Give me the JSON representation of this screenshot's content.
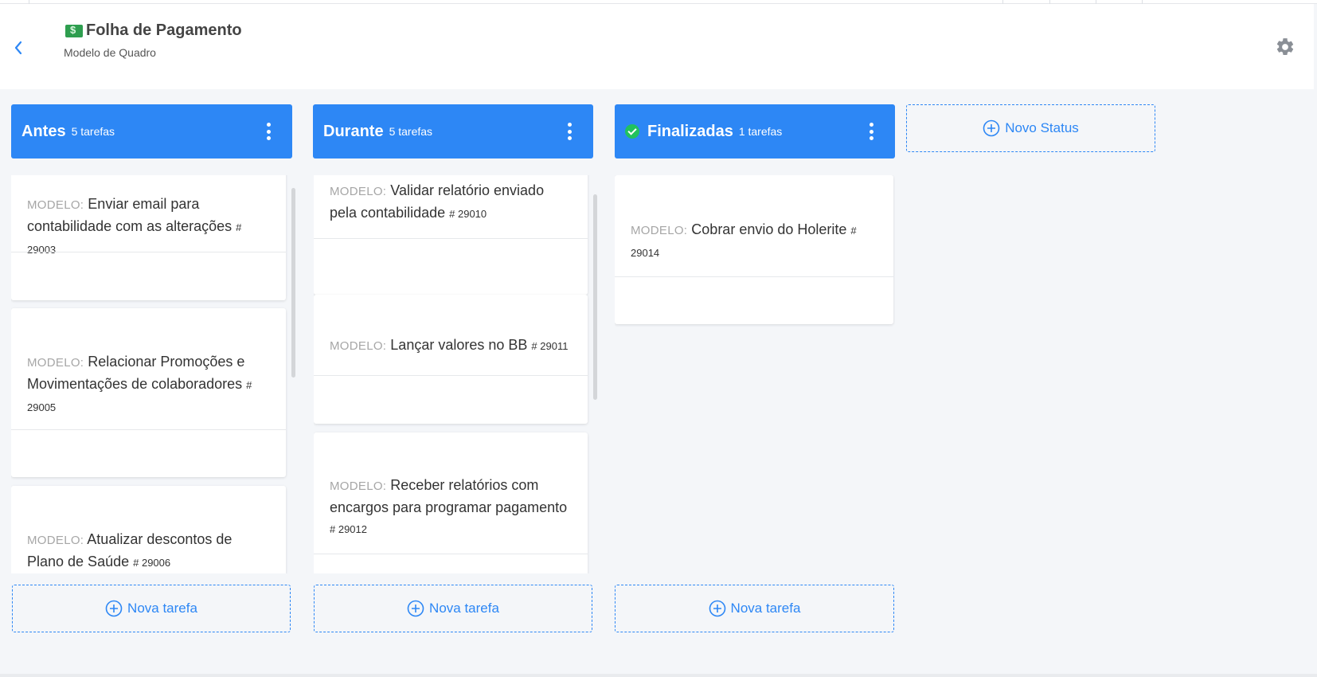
{
  "header": {
    "title": "Folha de Pagamento",
    "subtitle": "Modelo de Quadro",
    "title_icon": "money-icon",
    "back_icon": "chevron-left-icon",
    "settings_icon": "gear-icon"
  },
  "colors": {
    "accent": "#2d87f5",
    "done": "#21c25e",
    "background": "#f4f6f9"
  },
  "columns": [
    {
      "name": "Antes",
      "count": "5 tarefas",
      "add_label": "Nova tarefa",
      "cards": [
        {
          "label": "MODELO:",
          "text": "Enviar email para contabilidade com as alterações",
          "number": "# 29003"
        },
        {
          "label": "MODELO:",
          "text": "Relacionar Promoções e Movimentações de colaboradores",
          "number": "# 29005"
        },
        {
          "label": "MODELO:",
          "text": "Atualizar descontos de Plano de Saúde",
          "number": "# 29006"
        }
      ]
    },
    {
      "name": "Durante",
      "count": "5 tarefas",
      "add_label": "Nova tarefa",
      "cards": [
        {
          "label": "MODELO:",
          "text": "Validar relatório enviado pela contabilidade",
          "number": "# 29010"
        },
        {
          "label": "MODELO:",
          "text": "Lançar valores no BB",
          "number": "# 29011"
        },
        {
          "label": "MODELO:",
          "text": "Receber relatórios com encargos para programar pagamento",
          "number": "# 29012"
        }
      ]
    },
    {
      "name": "Finalizadas",
      "count": "1 tarefas",
      "add_label": "Nova tarefa",
      "cards": [
        {
          "label": "MODELO:",
          "text": "Cobrar envio do Holerite",
          "number": "# 29014"
        }
      ]
    }
  ],
  "new_status_label": "Novo Status"
}
